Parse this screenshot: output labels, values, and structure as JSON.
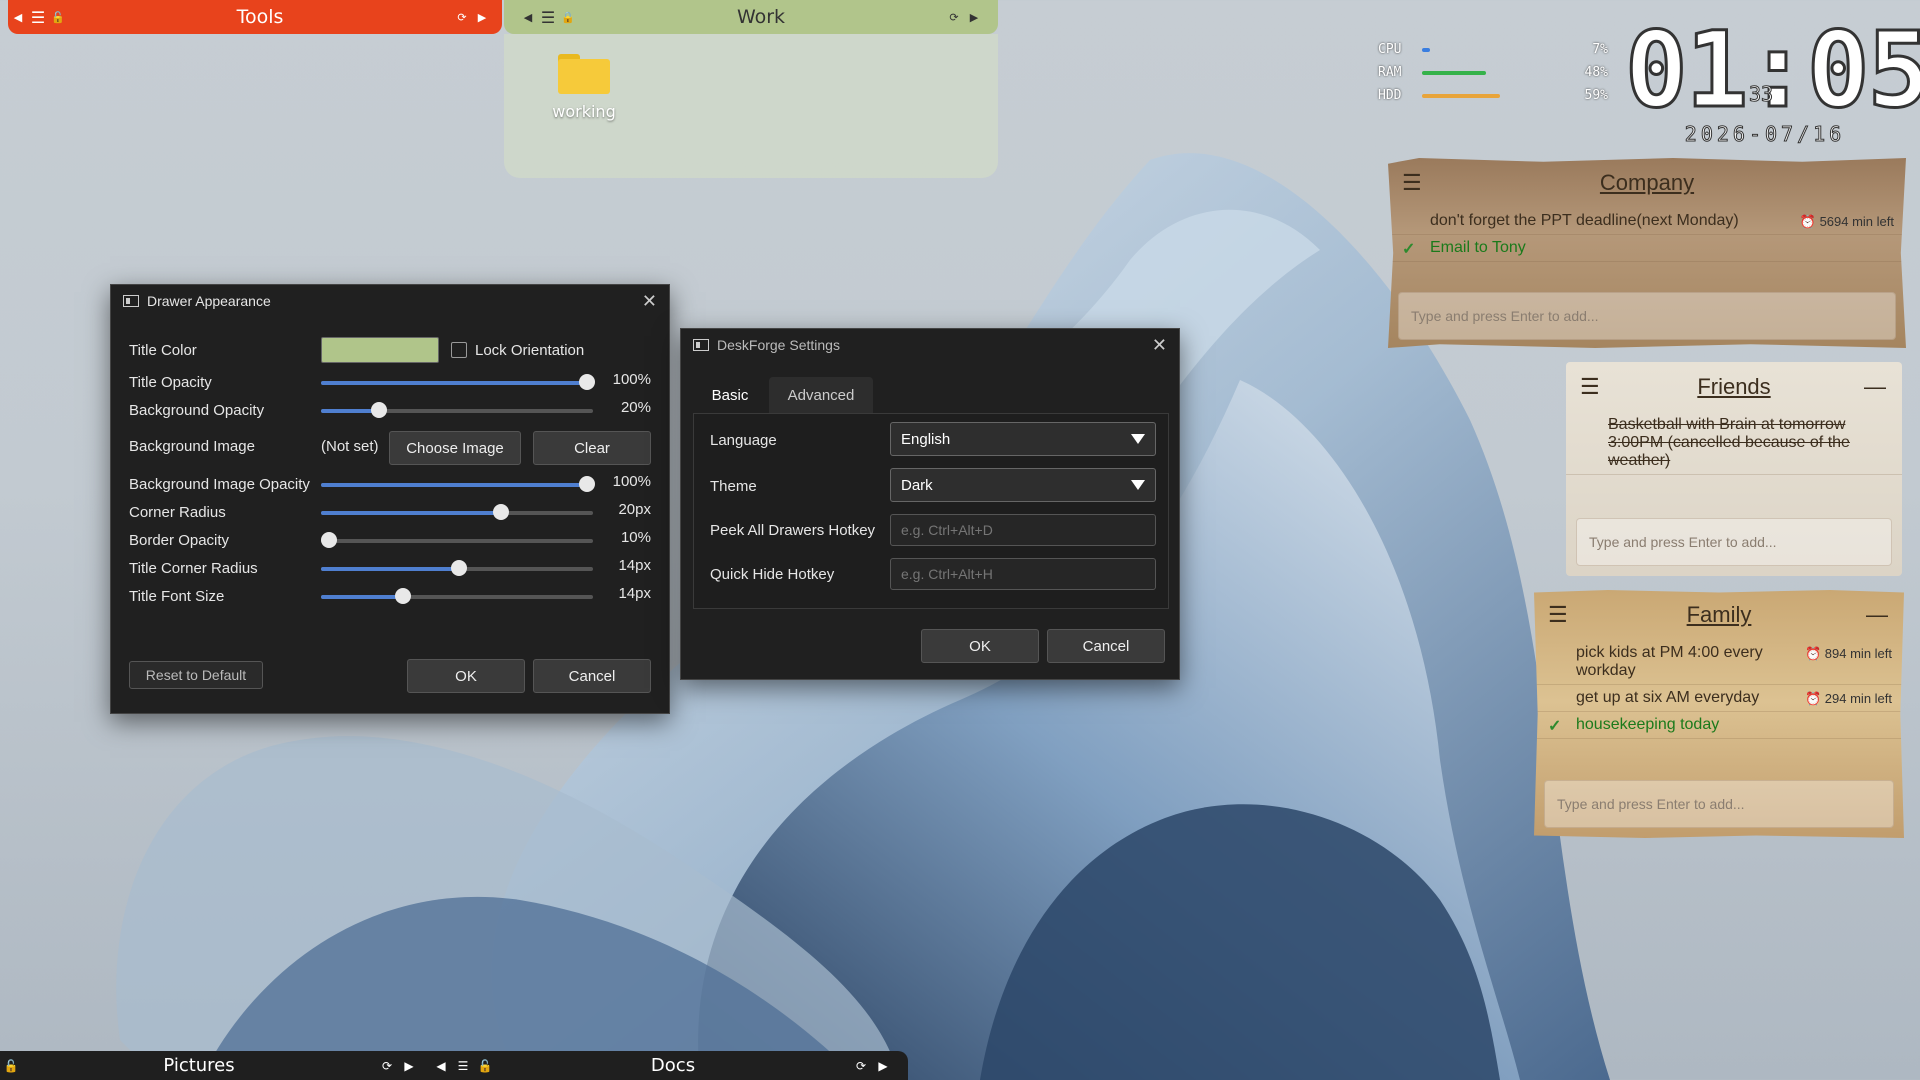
{
  "drawers": {
    "tools": {
      "title": "Tools"
    },
    "work": {
      "title": "Work",
      "items": [
        {
          "label": "working"
        }
      ]
    },
    "pictures": {
      "title": "Pictures"
    },
    "docs": {
      "title": "Docs"
    }
  },
  "sysmon": {
    "rows": [
      {
        "label": "CPU",
        "pct": "7%",
        "value": 0.07,
        "color": "#3a7ee0"
      },
      {
        "label": "RAM",
        "pct": "48%",
        "value": 0.48,
        "color": "#35b24a"
      },
      {
        "label": "HDD",
        "pct": "59%",
        "value": 0.59,
        "color": "#e8a43a"
      }
    ]
  },
  "clock": {
    "time": "01:05",
    "seconds": "33",
    "date": "2026-07/16"
  },
  "notes": {
    "company": {
      "title": "Company",
      "items": [
        {
          "text": "don't forget the PPT deadline(next Monday)",
          "timer": "5694 min left"
        },
        {
          "text": "Email to Tony",
          "done": true
        }
      ],
      "placeholder": "Type and press Enter to add..."
    },
    "friends": {
      "title": "Friends",
      "items": [
        {
          "text": "Basketball with Brain at tomorrow 3:00PM (cancelled because of the weather)"
        }
      ],
      "placeholder": "Type and press Enter to add..."
    },
    "family": {
      "title": "Family",
      "items": [
        {
          "text": "pick kids at PM 4:00  every workday",
          "timer": "894 min left"
        },
        {
          "text": "get up at six AM everyday",
          "timer": "294 min left"
        },
        {
          "text": "housekeeping today",
          "done": true
        }
      ],
      "placeholder": "Type and press Enter to add..."
    }
  },
  "appearance": {
    "title": "Drawer Appearance",
    "title_color_label": "Title Color",
    "title_color": "#b0c58a",
    "lock_orientation": "Lock Orientation",
    "bg_image_label": "Background Image",
    "bg_image_value": "(Not set)",
    "choose_image": "Choose Image",
    "clear": "Clear",
    "sliders": [
      {
        "label": "Title Opacity",
        "value": "100%",
        "fraction": 1.0
      },
      {
        "label": "Background Opacity",
        "value": "20%",
        "fraction": 0.2
      },
      {
        "label": "Background Image Opacity",
        "value": "100%",
        "fraction": 1.0
      },
      {
        "label": "Corner Radius",
        "value": "20px",
        "fraction": 0.66
      },
      {
        "label": "Border Opacity",
        "value": "10%",
        "fraction": 0.0
      },
      {
        "label": "Title Corner Radius",
        "value": "14px",
        "fraction": 0.5
      },
      {
        "label": "Title Font Size",
        "value": "14px",
        "fraction": 0.3
      }
    ],
    "reset": "Reset to Default",
    "ok": "OK",
    "cancel": "Cancel"
  },
  "settings": {
    "title": "DeskForge Settings",
    "tabs": [
      "Basic",
      "Advanced"
    ],
    "language_label": "Language",
    "language": "English",
    "theme_label": "Theme",
    "theme": "Dark",
    "peek_label": "Peek All Drawers Hotkey",
    "peek_placeholder": "e.g. Ctrl+Alt+D",
    "hide_label": "Quick Hide Hotkey",
    "hide_placeholder": "e.g. Ctrl+Alt+H",
    "ok": "OK",
    "cancel": "Cancel"
  }
}
